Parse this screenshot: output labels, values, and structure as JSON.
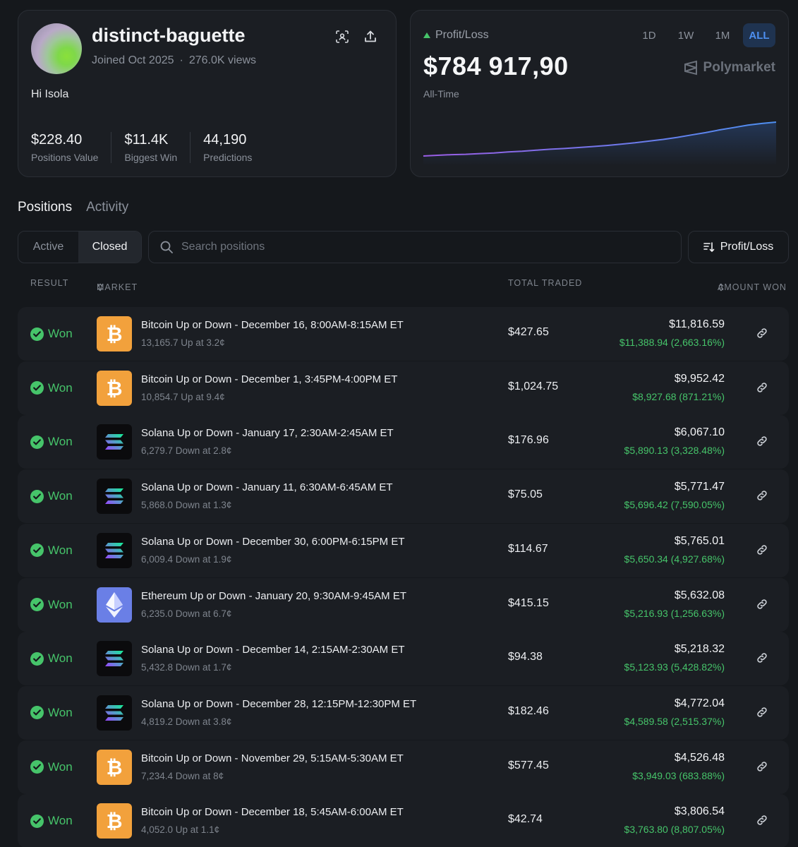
{
  "profile": {
    "username": "distinct-baguette",
    "joined": "Joined Oct 2025",
    "views": "276.0K views",
    "bio": "Hi Isola",
    "stats": [
      {
        "value": "$228.40",
        "label": "Positions Value"
      },
      {
        "value": "$11.4K",
        "label": "Biggest Win"
      },
      {
        "value": "44,190",
        "label": "Predictions"
      }
    ],
    "icons": [
      "scan-icon",
      "share-icon"
    ]
  },
  "pnl": {
    "label": "Profit/Loss",
    "value": "$784 917,90",
    "period_label": "All-Time",
    "ranges": [
      "1D",
      "1W",
      "1M",
      "ALL"
    ],
    "active_range": "ALL",
    "brand": "Polymarket",
    "sparkline": [
      0.0,
      0.02,
      0.04,
      0.05,
      0.07,
      0.09,
      0.12,
      0.14,
      0.17,
      0.2,
      0.22,
      0.25,
      0.28,
      0.31,
      0.35,
      0.39,
      0.44,
      0.49,
      0.55,
      0.62,
      0.69,
      0.77,
      0.84,
      0.91,
      0.96,
      1.0
    ],
    "colors": {
      "up": "#46c46a",
      "line_start": "#9b5de5",
      "line_end": "#4d8ff0",
      "active_range": "#4d8ff0"
    }
  },
  "tabs": {
    "positions": "Positions",
    "activity": "Activity"
  },
  "filters": {
    "active": "Active",
    "closed": "Closed",
    "search_placeholder": "Search positions",
    "sort_label": "Profit/Loss"
  },
  "table": {
    "headers": {
      "result": "RESULT",
      "market": "MARKET",
      "total": "TOTAL TRADED",
      "won": "AMOUNT WON"
    },
    "rows": [
      {
        "result": "Won",
        "coin": "btc",
        "title": "Bitcoin Up or Down - December 16, 8:00AM-8:15AM ET",
        "sub": "13,165.7 Up at 3.2¢",
        "total": "$427.65",
        "amount": "$11,816.59",
        "gain": "$11,388.94 (2,663.16%)"
      },
      {
        "result": "Won",
        "coin": "btc",
        "title": "Bitcoin Up or Down - December 1, 3:45PM-4:00PM ET",
        "sub": "10,854.7 Up at 9.4¢",
        "total": "$1,024.75",
        "amount": "$9,952.42",
        "gain": "$8,927.68 (871.21%)"
      },
      {
        "result": "Won",
        "coin": "sol",
        "title": "Solana Up or Down - January 17, 2:30AM-2:45AM ET",
        "sub": "6,279.7 Down at 2.8¢",
        "total": "$176.96",
        "amount": "$6,067.10",
        "gain": "$5,890.13 (3,328.48%)"
      },
      {
        "result": "Won",
        "coin": "sol",
        "title": "Solana Up or Down - January 11, 6:30AM-6:45AM ET",
        "sub": "5,868.0 Down at 1.3¢",
        "total": "$75.05",
        "amount": "$5,771.47",
        "gain": "$5,696.42 (7,590.05%)"
      },
      {
        "result": "Won",
        "coin": "sol",
        "title": "Solana Up or Down - December 30, 6:00PM-6:15PM ET",
        "sub": "6,009.4 Down at 1.9¢",
        "total": "$114.67",
        "amount": "$5,765.01",
        "gain": "$5,650.34 (4,927.68%)"
      },
      {
        "result": "Won",
        "coin": "eth",
        "title": "Ethereum Up or Down - January 20, 9:30AM-9:45AM ET",
        "sub": "6,235.0 Down at 6.7¢",
        "total": "$415.15",
        "amount": "$5,632.08",
        "gain": "$5,216.93 (1,256.63%)"
      },
      {
        "result": "Won",
        "coin": "sol",
        "title": "Solana Up or Down - December 14, 2:15AM-2:30AM ET",
        "sub": "5,432.8 Down at 1.7¢",
        "total": "$94.38",
        "amount": "$5,218.32",
        "gain": "$5,123.93 (5,428.82%)"
      },
      {
        "result": "Won",
        "coin": "sol",
        "title": "Solana Up or Down - December 28, 12:15PM-12:30PM ET",
        "sub": "4,819.2 Down at 3.8¢",
        "total": "$182.46",
        "amount": "$4,772.04",
        "gain": "$4,589.58 (2,515.37%)"
      },
      {
        "result": "Won",
        "coin": "btc",
        "title": "Bitcoin Up or Down - November 29, 5:15AM-5:30AM ET",
        "sub": "7,234.4 Down at 8¢",
        "total": "$577.45",
        "amount": "$4,526.48",
        "gain": "$3,949.03 (683.88%)"
      },
      {
        "result": "Won",
        "coin": "btc",
        "title": "Bitcoin Up or Down - December 18, 5:45AM-6:00AM ET",
        "sub": "4,052.0 Up at 1.1¢",
        "total": "$42.74",
        "amount": "$3,806.54",
        "gain": "$3,763.80 (8,807.05%)"
      }
    ]
  }
}
